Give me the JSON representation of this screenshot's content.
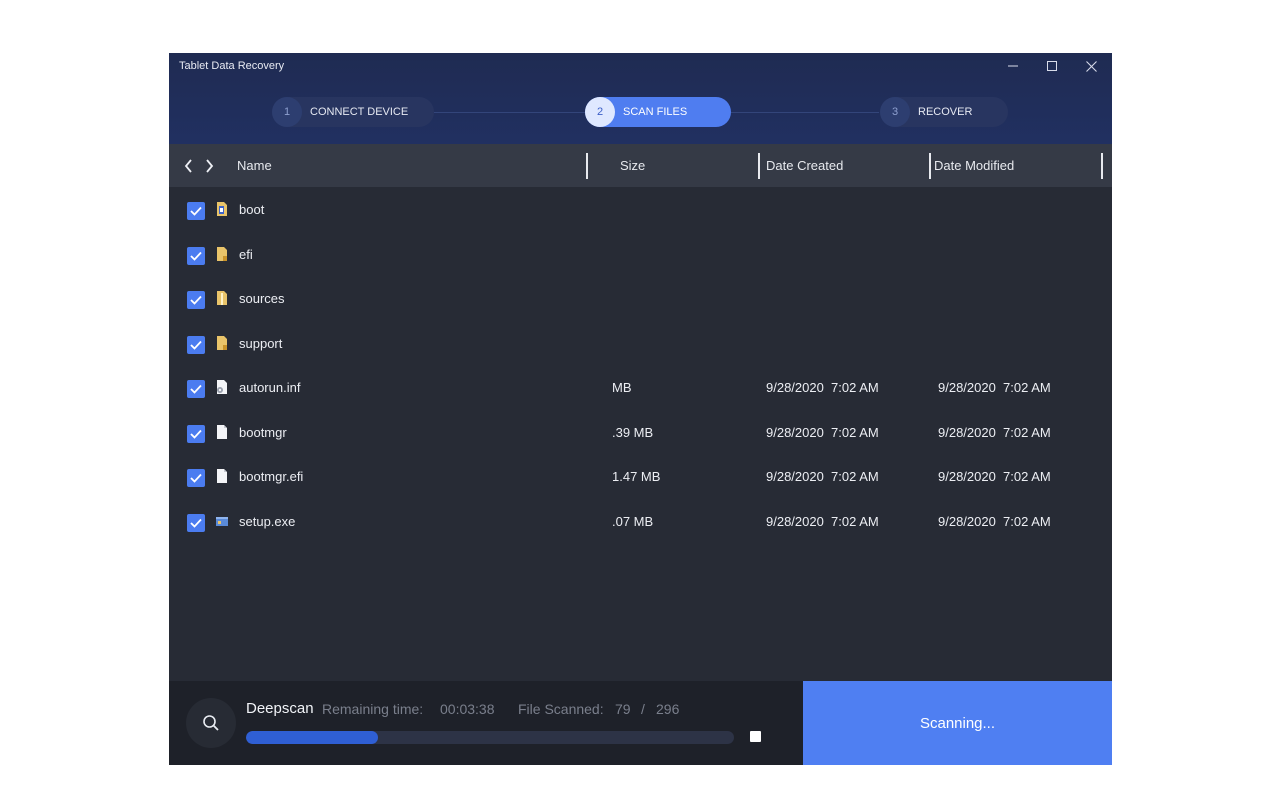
{
  "window": {
    "title": "Tablet Data Recovery"
  },
  "steps": [
    {
      "num": "1",
      "label": "CONNECT DEVICE",
      "active": false
    },
    {
      "num": "2",
      "label": "SCAN FILES",
      "active": true
    },
    {
      "num": "3",
      "label": "RECOVER",
      "active": false
    }
  ],
  "columns": {
    "name": "Name",
    "size": "Size",
    "created": "Date Created",
    "modified": "Date Modified"
  },
  "files": [
    {
      "name": "boot",
      "icon": "folder-icon",
      "size": "",
      "created": "",
      "modified": "",
      "checked": true
    },
    {
      "name": "efi",
      "icon": "folder-icon",
      "size": "",
      "created": "",
      "modified": "",
      "checked": true
    },
    {
      "name": "sources",
      "icon": "folder-icon",
      "size": "",
      "created": "",
      "modified": "",
      "checked": true
    },
    {
      "name": "support",
      "icon": "folder-icon",
      "size": "",
      "created": "",
      "modified": "",
      "checked": true
    },
    {
      "name": "autorun.inf",
      "icon": "settings-file-icon",
      "size": " MB",
      "created": "9/28/2020  7:02 AM",
      "modified": "9/28/2020  7:02 AM",
      "checked": true
    },
    {
      "name": "bootmgr",
      "icon": "file-icon",
      "size": ".39 MB",
      "created": "9/28/2020  7:02 AM",
      "modified": "9/28/2020  7:02 AM",
      "checked": true
    },
    {
      "name": "bootmgr.efi",
      "icon": "file-icon",
      "size": "1.47 MB",
      "created": "9/28/2020  7:02 AM",
      "modified": "9/28/2020  7:02 AM",
      "checked": true
    },
    {
      "name": "setup.exe",
      "icon": "exe-icon",
      "size": ".07 MB",
      "created": "9/28/2020  7:02 AM",
      "modified": "9/28/2020  7:02 AM",
      "checked": true
    }
  ],
  "status": {
    "mode": "Deepscan",
    "remaining_label": "Remaining time:",
    "remaining_value": "00:03:38",
    "scanned_label": "File Scanned:",
    "scanned_count": "79",
    "scanned_sep": "/",
    "scanned_total": "296",
    "progress": 0.27,
    "button_label": "Scanning..."
  },
  "colors": {
    "accent": "#4f7ff2",
    "progress": "#2f5fd4",
    "header": "#1f2b52",
    "folder": "#e9c46a"
  }
}
